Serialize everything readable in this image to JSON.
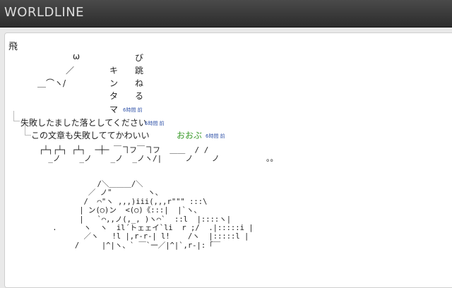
{
  "header": {
    "title": "WORLDLINE"
  },
  "post": {
    "kanji": "飛",
    "art_top": [
      {
        "text": "ω"
      },
      {
        "text": "／"
      },
      {
        "text": "＿⌒ヽ/"
      },
      {
        "text": "び"
      },
      {
        "text": "跳"
      },
      {
        "text": "ね"
      },
      {
        "text": "る"
      },
      {
        "text": "キ"
      },
      {
        "text": "ン"
      },
      {
        "text": "タ"
      },
      {
        "text": "マ"
      }
    ],
    "timestamp_1": "6時間 前"
  },
  "reply_1": {
    "text": "失敗したました落としてください",
    "timestamp": "6時間 前"
  },
  "reply_2": {
    "text": "この文章も失敗しててかわいい",
    "highlight": "おおぶ",
    "timestamp": "6時間 前"
  },
  "ascii_mid": "┌┴┐┌┴┐ ┌┴┐  ─┼─ ￣ヿフ￣ヿフ  ＿＿  / /\n  _ノ    _ノ    _ノ  _ノヽ/|     ノ    ノ          。。",
  "ascii_big": "              /＼＿＿＿/＼\n            ／ ノ\"        ヽ、\n           /  ⌒\"ヽ ,,,)iii(,,,r\"\"\" :::\\\n          | ン(○)ン  <(○)《:::|  |`ヽ、\n          |   `⌒,,ノ(,_, )ヽ⌒`  ::l  |::::ヽ|\n    .      ヽ  ヽ  il´トェェイ`li  r ;/  .|:::::i |\n           ／ヽ   !l |,r-r-| l!    /ヽ  |:::::l |\n         /     |^|ヽ、` ￣`一／|^|`,r-|:「￣"
}
